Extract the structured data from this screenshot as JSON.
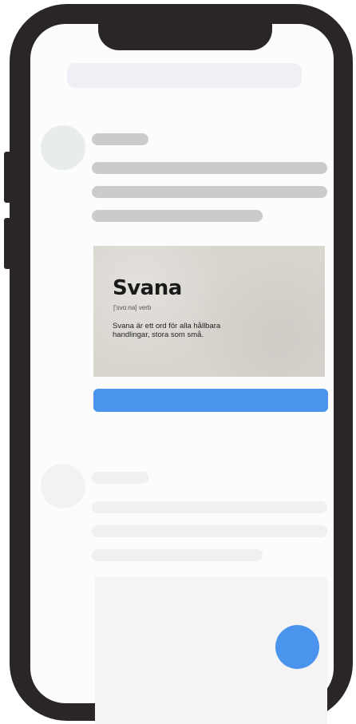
{
  "card": {
    "title": "Svana",
    "pronunciation": "['svɑːna] verb",
    "description": "Svana är ett ord för alla hållbara handlingar, stora som små."
  },
  "colors": {
    "accent": "#4a94ee",
    "phone_frame": "#2b2626",
    "skeleton": "#cbcbcb"
  }
}
